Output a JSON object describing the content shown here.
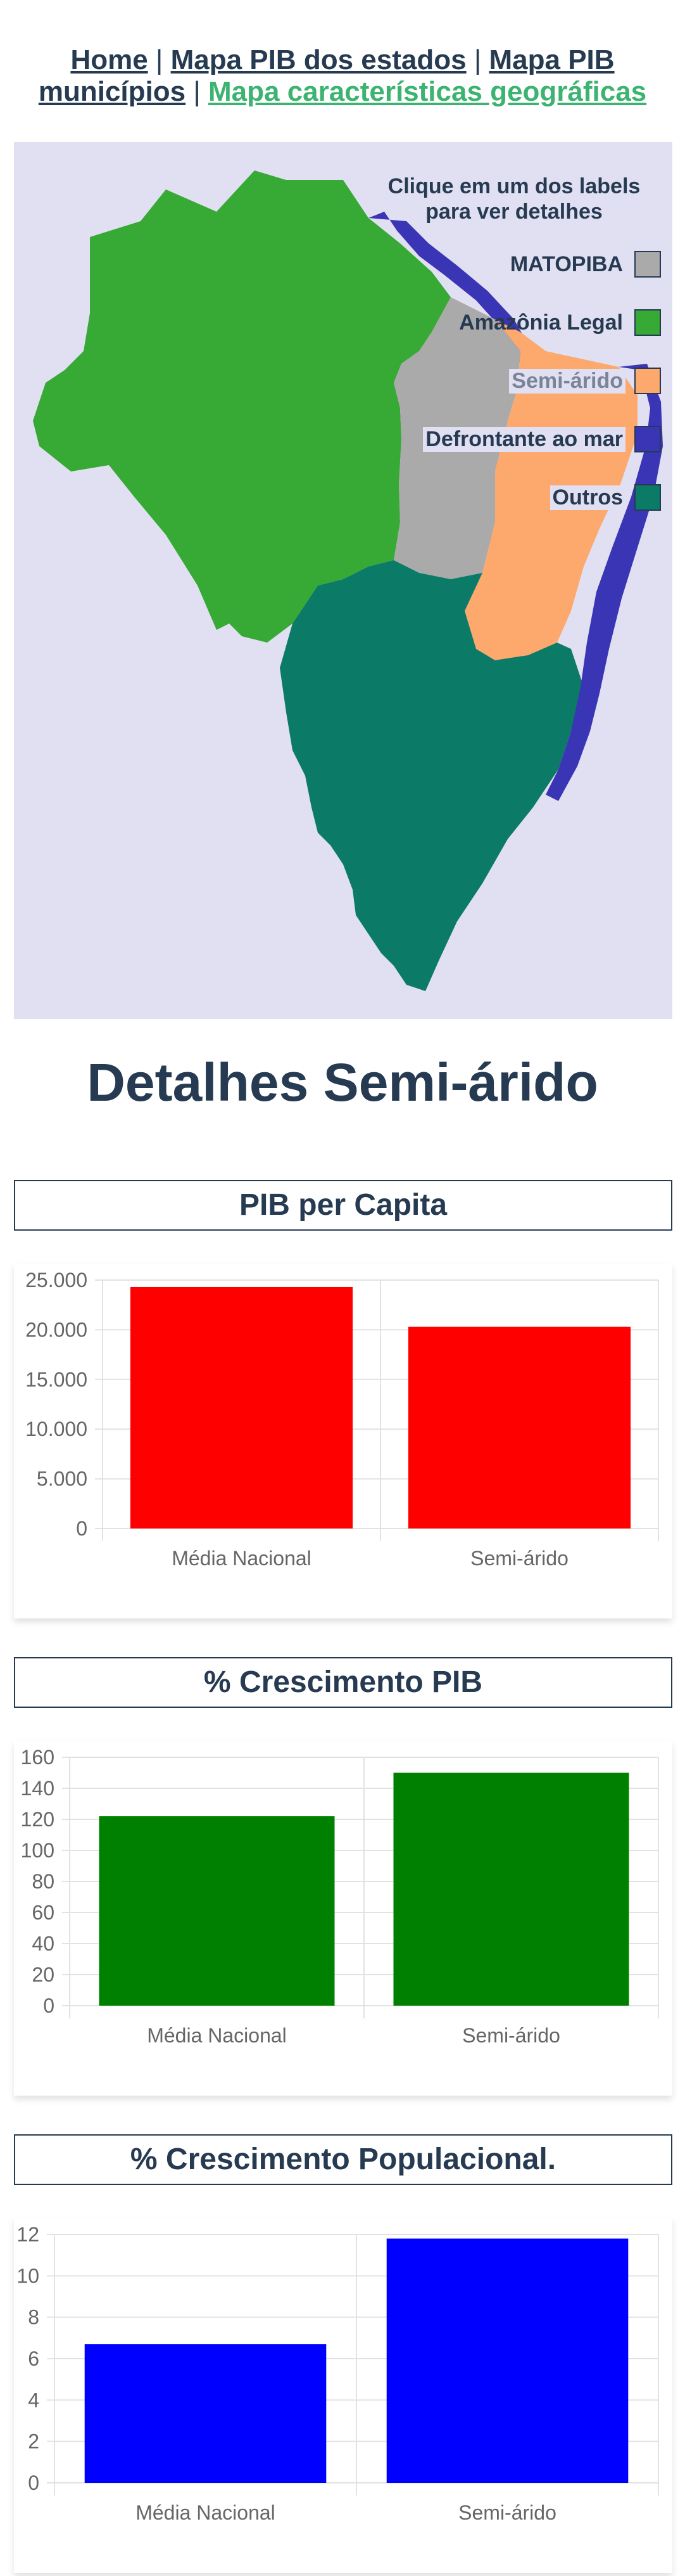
{
  "nav": {
    "links": [
      {
        "label": "Home",
        "active": false
      },
      {
        "label": "Mapa PIB dos estados",
        "active": false
      },
      {
        "label": "Mapa PIB municípios",
        "active": false
      },
      {
        "label": "Mapa características geográficas",
        "active": true
      }
    ],
    "separator": "|"
  },
  "map": {
    "legend_title": "Clique em um dos labels para ver detalhes",
    "legend": [
      {
        "label": "MATOPIBA",
        "color": "#aaaaaa"
      },
      {
        "label": "Amazônia Legal",
        "color": "#37a935"
      },
      {
        "label": "Semi-árido",
        "color": "#fda86c"
      },
      {
        "label": "Defrontante ao mar",
        "color": "#3a35b4"
      },
      {
        "label": "Outros",
        "color": "#0b7a66"
      }
    ]
  },
  "details": {
    "title": "Detalhes Semi-árido"
  },
  "chart_data": [
    {
      "type": "bar",
      "title": "PIB per Capita",
      "categories": [
        "Média Nacional",
        "Semi-árido"
      ],
      "values": [
        24300,
        20300
      ],
      "ylim": [
        0,
        25000
      ],
      "yticks": [
        0,
        5000,
        10000,
        15000,
        20000,
        25000
      ],
      "ytick_labels": [
        "0",
        "5.000",
        "10.000",
        "15.000",
        "20.000",
        "25.000"
      ],
      "color": "#ff0000",
      "grid": true
    },
    {
      "type": "bar",
      "title": "% Crescimento PIB",
      "categories": [
        "Média Nacional",
        "Semi-árido"
      ],
      "values": [
        122,
        150
      ],
      "ylim": [
        0,
        160
      ],
      "yticks": [
        0,
        20,
        40,
        60,
        80,
        100,
        120,
        140,
        160
      ],
      "ytick_labels": [
        "0",
        "20",
        "40",
        "60",
        "80",
        "100",
        "120",
        "140",
        "160"
      ],
      "color": "#008000",
      "grid": true
    },
    {
      "type": "bar",
      "title": "% Crescimento Populacional.",
      "categories": [
        "Média Nacional",
        "Semi-árido"
      ],
      "values": [
        6.7,
        11.8
      ],
      "ylim": [
        0,
        12
      ],
      "yticks": [
        0,
        2,
        4,
        6,
        8,
        10,
        12
      ],
      "ytick_labels": [
        "0",
        "2",
        "4",
        "6",
        "8",
        "10",
        "12"
      ],
      "color": "#0000ff",
      "grid": true
    }
  ]
}
